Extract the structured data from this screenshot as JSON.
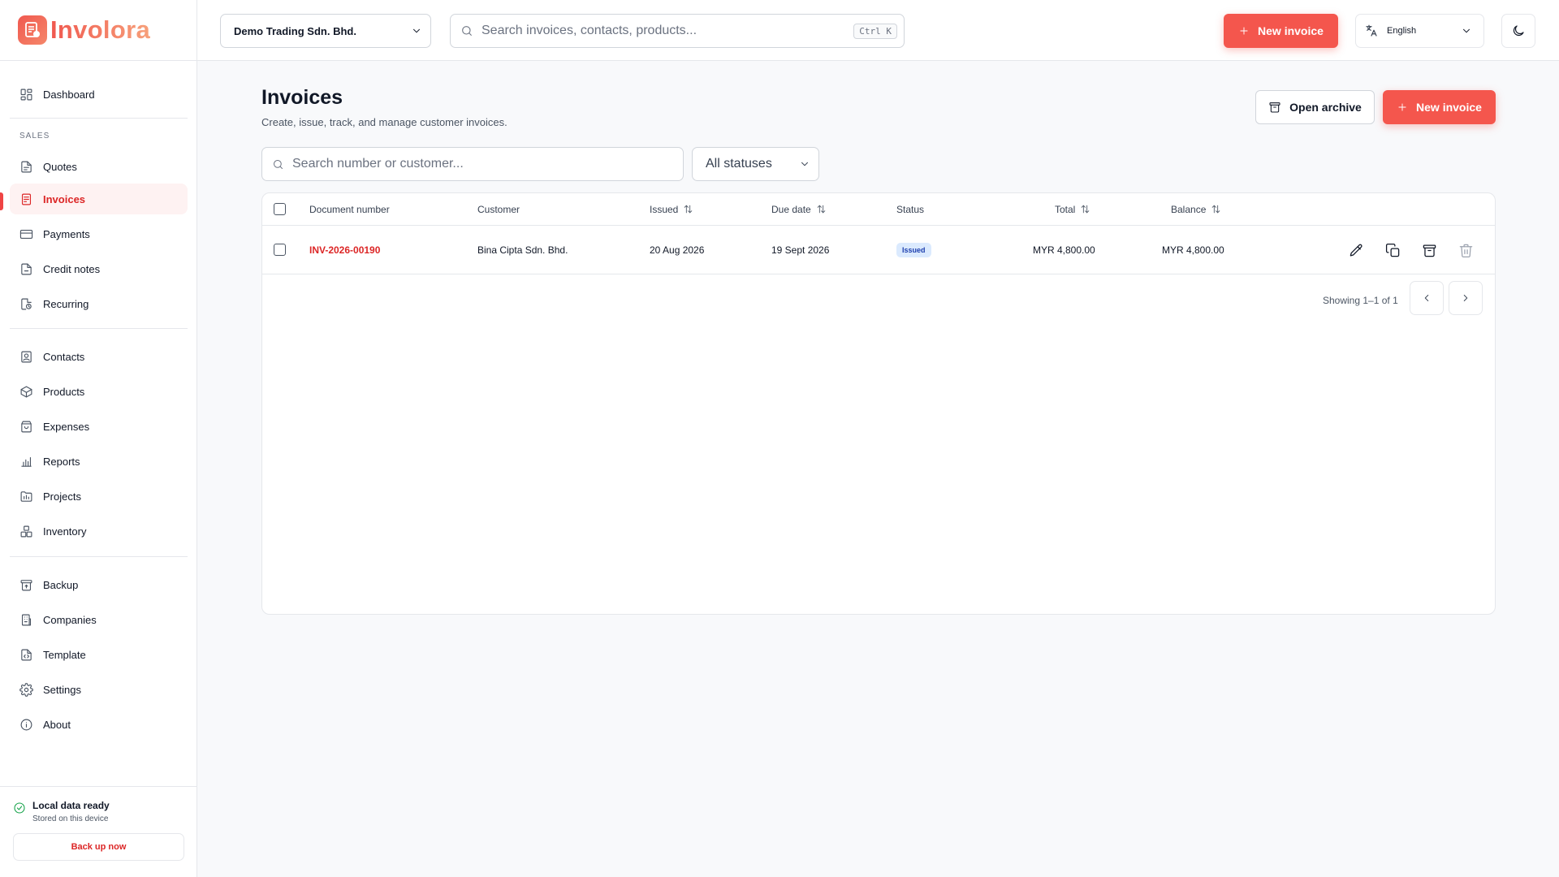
{
  "app": {
    "name": "Involora"
  },
  "sidebar": {
    "dashboard": "Dashboard",
    "section_sales": "SALES",
    "items": {
      "quotes": "Quotes",
      "invoices": "Invoices",
      "payments": "Payments",
      "credit_notes": "Credit notes",
      "recurring": "Recurring",
      "contacts": "Contacts",
      "products": "Products",
      "expenses": "Expenses",
      "reports": "Reports",
      "projects": "Projects",
      "inventory": "Inventory",
      "backup": "Backup",
      "companies": "Companies",
      "template": "Template",
      "settings": "Settings",
      "about": "About"
    },
    "active": "invoices",
    "footer": {
      "status_title": "Local data ready",
      "status_sub": "Stored on this device",
      "backup_button": "Back up now"
    }
  },
  "topbar": {
    "company": "Demo Trading Sdn. Bhd.",
    "search_placeholder": "Search invoices, contacts, products...",
    "shortcut": "Ctrl K",
    "new_invoice": "New invoice",
    "language": "English"
  },
  "page": {
    "title": "Invoices",
    "subtitle": "Create, issue, track, and manage customer invoices.",
    "open_archive": "Open archive",
    "new_invoice": "New invoice",
    "search_placeholder": "Search number or customer...",
    "status_filter": "All statuses"
  },
  "table": {
    "columns": {
      "document_number": "Document number",
      "customer": "Customer",
      "issued": "Issued",
      "due_date": "Due date",
      "status": "Status",
      "total": "Total",
      "balance": "Balance"
    },
    "rows": [
      {
        "number": "INV-2026-00190",
        "customer": "Bina Cipta Sdn. Bhd.",
        "issued": "20 Aug 2026",
        "due": "19 Sept 2026",
        "status": "Issued",
        "total": "MYR 4,800.00",
        "balance": "MYR 4,800.00"
      }
    ],
    "pagination": "Showing 1–1 of 1"
  },
  "colors": {
    "accent": "#f4564d",
    "accent_text": "#dc2626",
    "status_badge_bg": "#dbeafe",
    "status_badge_text": "#1e40af",
    "success": "#16a34a"
  },
  "icons": {
    "dashboard": "layout-grid-icon",
    "quotes": "document-icon",
    "invoices": "receipt-icon",
    "payments": "credit-card-icon",
    "credit_notes": "file-minus-icon",
    "recurring": "recurring-icon",
    "contacts": "contact-icon",
    "products": "box-icon",
    "expenses": "wallet-icon",
    "reports": "bar-chart-icon",
    "projects": "folder-icon",
    "inventory": "boxes-icon",
    "backup": "archive-icon",
    "companies": "building-icon",
    "template": "file-code-icon",
    "settings": "gear-icon",
    "about": "info-icon"
  }
}
